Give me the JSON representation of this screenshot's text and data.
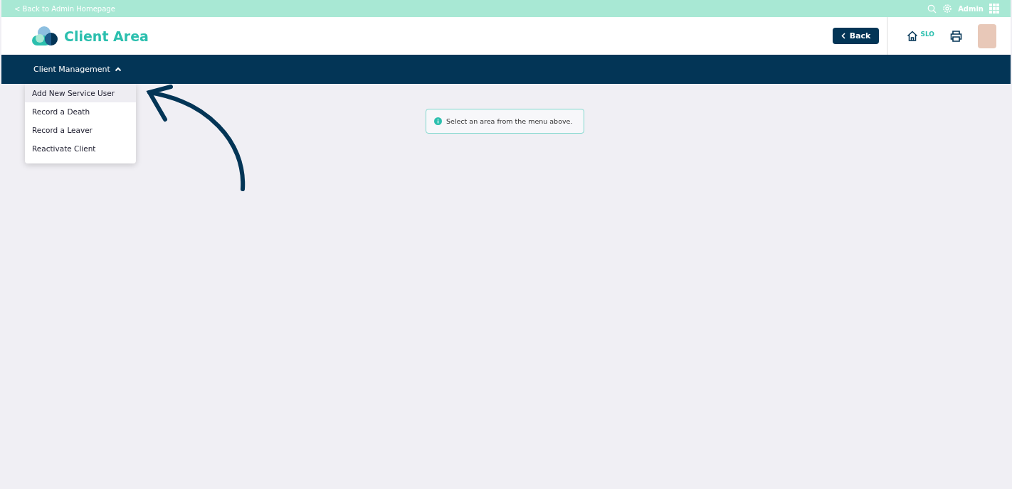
{
  "top_bar": {
    "back_link": "< Back to Admin Homepage",
    "user_label": "Admin"
  },
  "header": {
    "title": "Client Area",
    "back_button": "Back",
    "home_label": "SLO"
  },
  "nav": {
    "items": [
      {
        "label": "Client Management",
        "expanded": true
      }
    ]
  },
  "dropdown": {
    "items": [
      {
        "label": "Add New Service User",
        "selected": true
      },
      {
        "label": "Record a Death",
        "selected": false
      },
      {
        "label": "Record a Leaver",
        "selected": false
      },
      {
        "label": "Reactivate Client",
        "selected": false
      }
    ]
  },
  "alert": {
    "message": "Select an area from the menu above."
  }
}
